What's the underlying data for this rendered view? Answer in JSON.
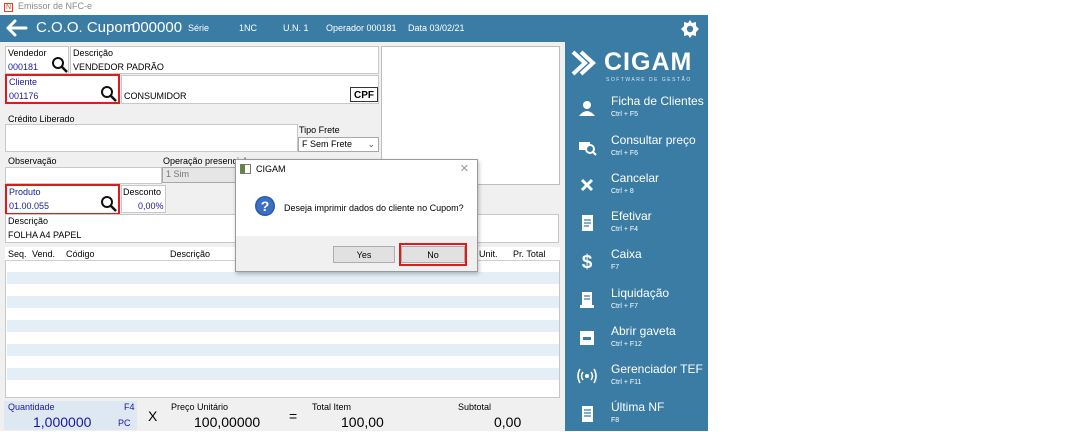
{
  "window": {
    "title": "Emissor de NFC-e"
  },
  "header": {
    "title": "C.O.O. Cupom",
    "coo": "000000",
    "serie_label": "Série",
    "serie_value": "1NC",
    "un": "U.N. 1",
    "operador": "Operador 000181",
    "data": "Data  03/02/21"
  },
  "form": {
    "vendedor_label": "Vendedor",
    "vendedor_code": "000181",
    "descricao_label": "Descrição",
    "vendedor_desc": "VENDEDOR PADRÃO",
    "cliente_label": "Cliente",
    "cliente_code": "001176",
    "cliente_desc": "CONSUMIDOR",
    "cpf_label": "CPF",
    "credito_label": "Crédito Liberado",
    "tipo_frete_label": "Tipo Frete",
    "tipo_frete_value": "F Sem Frete",
    "observacao_label": "Observação",
    "operacao_label": "Operação presencial",
    "operacao_value": "1 Sim",
    "produto_label": "Produto",
    "produto_code": "01.00.055",
    "desconto_label": "Desconto",
    "desconto_value": "0,00%",
    "descricao2_label": "Descrição",
    "produto_desc": "FOLHA A4 PAPEL"
  },
  "grid": {
    "columns": [
      "Seq.",
      "Vend.",
      "Código",
      "Descrição",
      "Unit.",
      "Pr. Total"
    ]
  },
  "totals": {
    "quantidade_label": "Quantidade",
    "quantidade_key": "F4",
    "quantidade_value": "1,000000",
    "unidade": "PC",
    "times": "X",
    "preco_label": "Preço Unitário",
    "preco_value": "100,00000",
    "equals": "=",
    "total_item_label": "Total Item",
    "total_item_value": "100,00",
    "subtotal_label": "Subtotal",
    "subtotal_value": "0,00"
  },
  "dialog": {
    "title": "CIGAM",
    "message": "Deseja imprimir dados do cliente no Cupom?",
    "yes_label": "Yes",
    "no_label": "No"
  },
  "sidebar": {
    "logo_text": "CIGAM",
    "logo_sub": "SOFTWARE DE GESTÃO",
    "items": [
      {
        "label": "Ficha de Clientes",
        "shortcut": "Ctrl + F5",
        "icon": "user-card-icon"
      },
      {
        "label": "Consultar preço",
        "shortcut": "Ctrl + F6",
        "icon": "price-search-icon"
      },
      {
        "label": "Cancelar",
        "shortcut": "Ctrl + 8",
        "icon": "close-icon"
      },
      {
        "label": "Efetivar",
        "shortcut": "Ctrl + F4",
        "icon": "document-icon"
      },
      {
        "label": "Caixa",
        "shortcut": "F7",
        "icon": "dollar-icon"
      },
      {
        "label": "Liquidação",
        "shortcut": "Ctrl + F7",
        "icon": "receipt-icon"
      },
      {
        "label": "Abrir gaveta",
        "shortcut": "Ctrl + F12",
        "icon": "drawer-icon"
      },
      {
        "label": "Gerenciador TEF",
        "shortcut": "Ctrl + F11",
        "icon": "wireless-icon"
      },
      {
        "label": "Última NF",
        "shortcut": "F8",
        "icon": "invoice-icon"
      }
    ]
  },
  "colors": {
    "brand": "#3a7ca3",
    "highlight": "#e01a1a",
    "value_text": "#1a1a9a"
  }
}
